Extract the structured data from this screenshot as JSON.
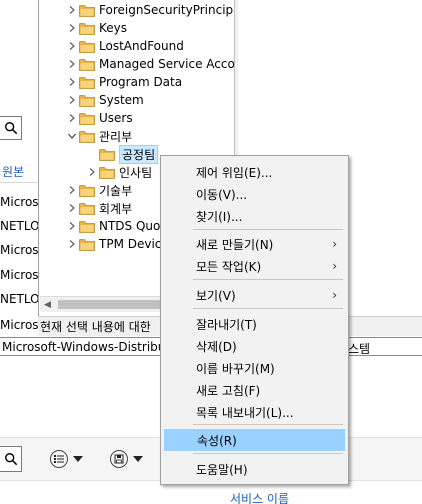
{
  "left_panel": {
    "source_header": "원본",
    "rows": [
      "Microsoft",
      "NETLOGON",
      "Microsoft",
      "Microsoft",
      "NETLOGON",
      "Microsoft"
    ]
  },
  "tree": {
    "items": [
      {
        "label": "ForeignSecurityPrincipal",
        "expander": "right"
      },
      {
        "label": "Keys",
        "expander": "right"
      },
      {
        "label": "LostAndFound",
        "expander": "right"
      },
      {
        "label": "Managed Service Accou",
        "expander": "right"
      },
      {
        "label": "Program Data",
        "expander": "right"
      },
      {
        "label": "System",
        "expander": "right"
      },
      {
        "label": "Users",
        "expander": "right"
      },
      {
        "label": "관리부",
        "expander": "down"
      },
      {
        "label": "공정팀",
        "expander": "none",
        "selected": true
      },
      {
        "label": "인사팀",
        "expander": "right"
      },
      {
        "label": "기술부",
        "expander": "right"
      },
      {
        "label": "회계부",
        "expander": "right"
      },
      {
        "label": "NTDS Quo",
        "expander": "right"
      },
      {
        "label": "TPM Devic",
        "expander": "right"
      }
    ]
  },
  "status_bar": {
    "text": "현재 선택 내용에 대한"
  },
  "service_bar": {
    "text": "Microsoft-Windows-Distributed",
    "right_text": "스템"
  },
  "bottom": {
    "caption": "서비스 이름"
  },
  "context_menu": {
    "items": [
      {
        "label": "제어 위임(E)...",
        "submenu": false
      },
      {
        "label": "이동(V)...",
        "submenu": false
      },
      {
        "label": "찾기(I)...",
        "submenu": false
      },
      {
        "label": "새로 만들기(N)",
        "submenu": true
      },
      {
        "label": "모든 작업(K)",
        "submenu": true
      },
      {
        "label": "보기(V)",
        "submenu": true
      },
      {
        "label": "잘라내기(T)",
        "submenu": false
      },
      {
        "label": "삭제(D)",
        "submenu": false
      },
      {
        "label": "이름 바꾸기(M)",
        "submenu": false
      },
      {
        "label": "새로 고침(F)",
        "submenu": false
      },
      {
        "label": "목록 내보내기(L)...",
        "submenu": false
      },
      {
        "label": "속성(R)",
        "submenu": false,
        "highlighted": true
      },
      {
        "label": "도움말(H)",
        "submenu": false
      }
    ],
    "submenu_arrow": "›"
  },
  "colors": {
    "menu_highlight": "#99d1ff",
    "selection": "#cce8ff",
    "link_blue": "#1a5fb4",
    "folder_yellow": "#e8b646"
  },
  "icons": {
    "folder": "folder-icon",
    "search": "search-icon",
    "chevron_right": "chevron-right-icon",
    "chevron_down": "chevron-down-icon"
  }
}
